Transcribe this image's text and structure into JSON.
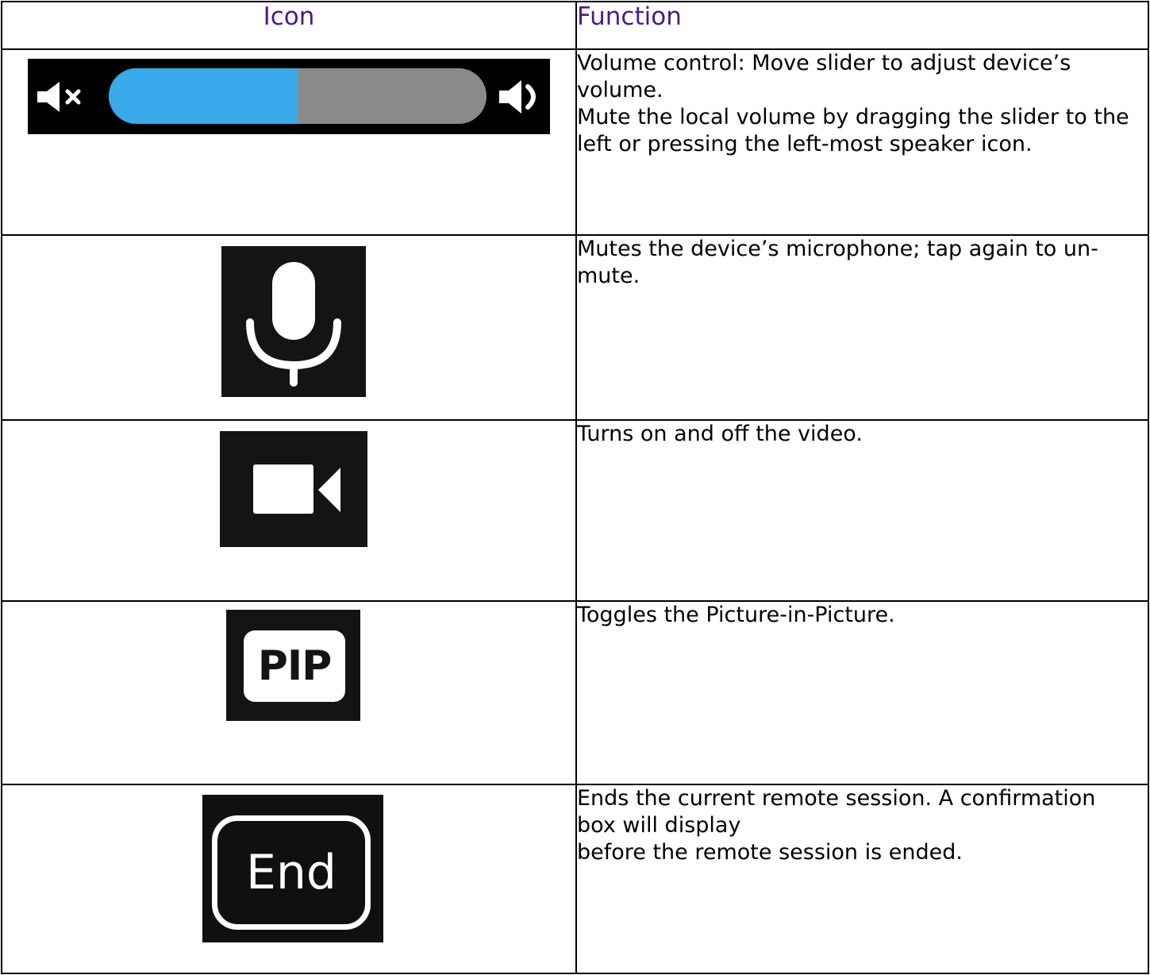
{
  "table": {
    "headers": {
      "icon": "Icon",
      "function": "Function"
    },
    "rows": [
      {
        "icon": "volume-slider-icon",
        "volume_level": 0.5,
        "colors": {
          "fill": "#39a9ea",
          "track": "#8a8a8a",
          "background": "#000000"
        },
        "function_lines": [
          "Volume control: Move slider to adjust device’s",
          "volume.",
          "Mute the local volume by dragging the slider to the",
          "left or pressing the left-most speaker icon."
        ]
      },
      {
        "icon": "microphone-icon",
        "function_lines": [
          "Mutes the device’s microphone; tap again to un-",
          "mute."
        ]
      },
      {
        "icon": "video-camera-icon",
        "function_lines": [
          "Turns on and off the video."
        ]
      },
      {
        "icon": "pip-icon",
        "icon_label": "PIP",
        "function_lines": [
          "Toggles the Picture-in-Picture."
        ]
      },
      {
        "icon": "end-icon",
        "icon_label": "End",
        "function_lines": [
          "Ends the current remote session. A confirmation",
          "box will display",
          "before the remote session is ended."
        ]
      }
    ]
  },
  "colors": {
    "header_text": "#4b1a8c",
    "border": "#000000",
    "body_text": "#000000"
  }
}
